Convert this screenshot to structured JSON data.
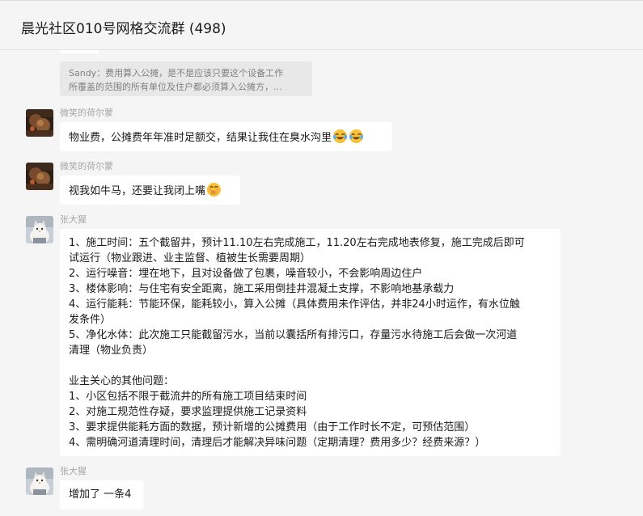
{
  "header": {
    "title": "晨光社区010号网格交流群 (498)"
  },
  "quote": {
    "text": "Sandy：费用算入公摊，是不是应该只要这个设备工作\n所覆盖的范围的所有单位及住户都必须算入公摊方，..."
  },
  "messages": [
    {
      "sender": "微笑的荷尔蒙",
      "text": "物业费，公摊费年年准时足额交，结果让我住在臭水沟里",
      "emoji": [
        "joy-emoji",
        "joy-emoji"
      ]
    },
    {
      "sender": "微笑的荷尔蒙",
      "text": "视我如牛马，还要让我闭上嘴",
      "emoji": [
        "hand-over-mouth-emoji"
      ]
    },
    {
      "sender": "张大猩",
      "lines": [
        "1、施工时间：五个截留井，预计11.10左右完成施工，11.20左右完成地表修复，施工完成后即可",
        "试运行（物业跟进、业主监督、植被生长需要周期）",
        "2、运行噪音：埋在地下，且对设备做了包裹，噪音较小，不会影响周边住户",
        "3、楼体影响：与住宅有安全距离，施工采用倒挂井混凝土支撑，不影响地基承载力",
        "4、运行能耗：节能环保，能耗较小，算入公摊（具体费用未作评估，并非24小时运作，有水位触",
        "发条件）",
        "5、净化水体：此次施工只能截留污水，当前以囊括所有排污口，存量污水待施工后会做一次河道",
        "清理（物业负责）",
        "",
        "业主关心的其他问题：",
        "1、小区包括不限于截流井的所有施工项目结束时间",
        "2、对施工规范性存疑，要求监理提供施工记录资料",
        "3、要求提供能耗方面的数据，预计新增的公摊费用（由于工作时长不定，可预估范围）",
        "4、需明确河道清理时间，清理后才能解决异味问题（定期清理？费用多少？经费来源？）"
      ]
    },
    {
      "sender": "张大猩",
      "text": "增加了 一条4"
    }
  ],
  "colors": {
    "background": "#f5f5f5",
    "bubble": "#ffffff",
    "quote_bg": "#e8e8e8",
    "sender_name": "#a6a6a6"
  }
}
